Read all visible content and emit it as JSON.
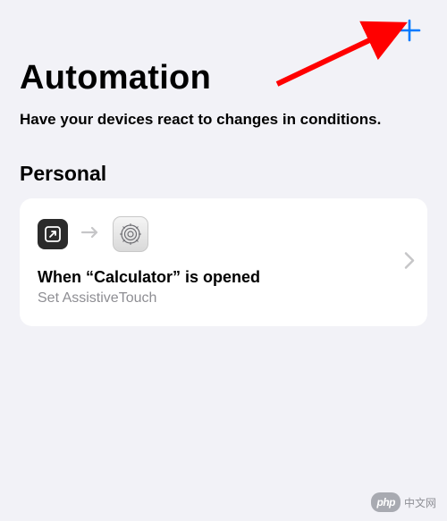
{
  "header": {
    "add_icon": "plus-icon"
  },
  "page": {
    "title": "Automation",
    "subtitle": "Have your devices react to changes in conditions."
  },
  "section": {
    "title": "Personal"
  },
  "automation": {
    "icon1_name": "shortcuts-app-icon",
    "arrow_name": "arrow-right-icon",
    "icon2_name": "settings-app-icon",
    "title": "When “Calculator” is opened",
    "subtitle": "Set AssistiveTouch",
    "chevron_name": "chevron-right-icon"
  },
  "watermark": {
    "badge": "php",
    "text": "中文网"
  },
  "annotation": {
    "arrow_color": "#ff0000"
  }
}
